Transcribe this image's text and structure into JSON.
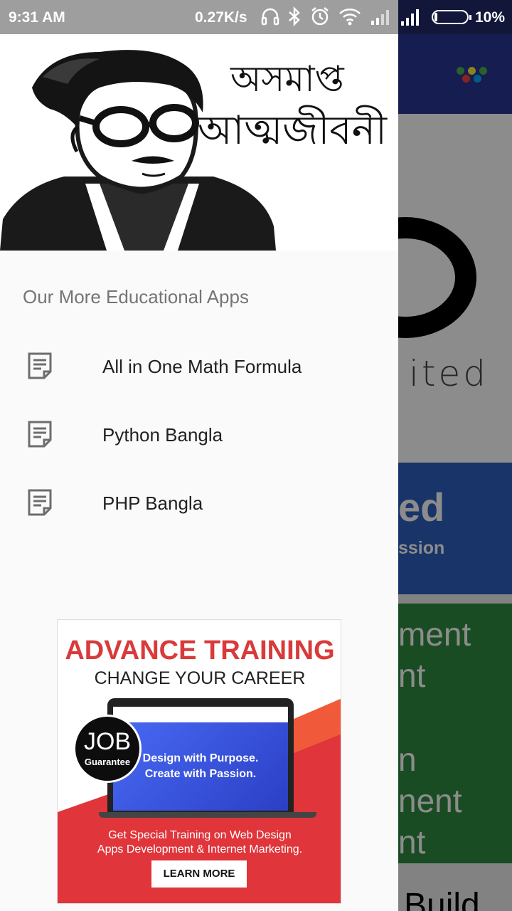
{
  "status_bar": {
    "time": "9:31 AM",
    "network_speed": "0.27K/s",
    "battery": "10%",
    "icons": [
      "headset-icon",
      "bluetooth-icon",
      "alarm-icon",
      "wifi-icon",
      "signal-icon",
      "signal-icon",
      "battery-icon"
    ],
    "battery_level": 0.1
  },
  "drawer": {
    "header": {
      "title_line_1": "অসমাপ্ত",
      "title_line_2": "আত্মজীবনী"
    },
    "section_title": "Our More Educational Apps",
    "items": [
      {
        "label": "All in One Math Formula",
        "icon": "document-icon"
      },
      {
        "label": "Python Bangla",
        "icon": "document-icon"
      },
      {
        "label": "PHP Bangla",
        "icon": "document-icon"
      }
    ]
  },
  "ad": {
    "title": "ADVANCE TRAINING",
    "subtitle": "CHANGE YOUR CAREER",
    "badge_main": "JOB",
    "badge_sub": "Guarantee",
    "screen_line_1": "Design with Purpose.",
    "screen_line_2": "Create with Passion.",
    "desc_line_1": "Get Special Training on Web Design",
    "desc_line_2": "Apps Development & Internet Marketing.",
    "button": "LEARN MORE"
  },
  "background": {
    "logo_text": "ited",
    "blue_card_big": "ed",
    "blue_card_small": "ssion",
    "green_card_lines": [
      "ment",
      "nt",
      "n",
      "nent",
      "nt"
    ],
    "bottom_text": "Build"
  },
  "colors": {
    "toolbar": "#283593",
    "ad_red": "#e0353a",
    "blue_card": "#2d5fc0",
    "green_card": "#2e8b3e"
  }
}
